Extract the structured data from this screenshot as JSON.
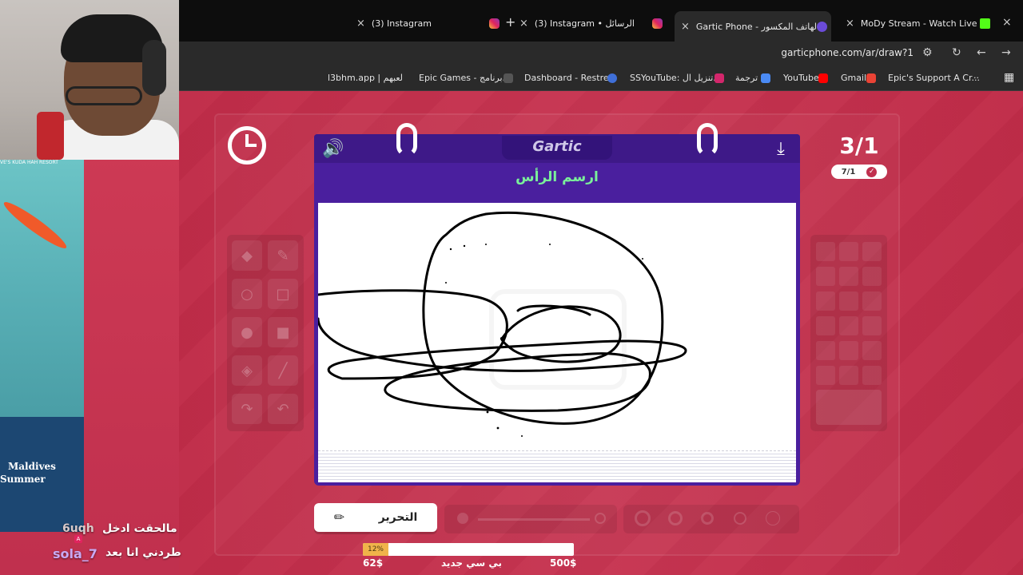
{
  "browser": {
    "tabs": [
      {
        "title": "(3) Instagram",
        "active": false
      },
      {
        "title": "(3) Instagram • الرسائل",
        "active": false
      },
      {
        "title": "Gartic Phone - الهاتف المكسور",
        "active": true
      },
      {
        "title": "MoDy Stream - Watch Live on",
        "active": false
      }
    ],
    "new_tab_label": "+",
    "url": "garticphone.com/ar/draw?1",
    "bookmarks": [
      "l3bhm.app | لعبهم",
      "Epic Games - برنامج...",
      "Dashboard - Restre...",
      "SSYouTube: تنزيل ال...",
      "ترجمة",
      "YouTube",
      "Gmail",
      "Epic's Support A Cr..."
    ]
  },
  "game": {
    "logo": "Gartic",
    "prompt": "ارسم الرأس",
    "round_main": "3/1",
    "round_sub": "7/1",
    "edit_button_label": "التحرير"
  },
  "stream": {
    "ad_caption_top": "VE'S KUDA HAH RESORT",
    "ad_text_line1": "Maldives",
    "ad_text_line2": "Summer",
    "chat": [
      {
        "user": "6uqh",
        "message": "مالحقت ادخل",
        "user_color": "#d9c9c9"
      },
      {
        "user": "sola_7",
        "message": "طردني انا بعد",
        "user_color": "#c9a9f2"
      }
    ],
    "goal": {
      "percent_label": "12%",
      "progress": 0.12,
      "start": "62$",
      "title": "بي سي جديد",
      "target": "500$"
    }
  },
  "colors": {
    "page_bg": "#c0304e",
    "notebook": "#4a1f9e",
    "prompt_text": "#7af09a",
    "goal_fill": "#f0b34a"
  }
}
